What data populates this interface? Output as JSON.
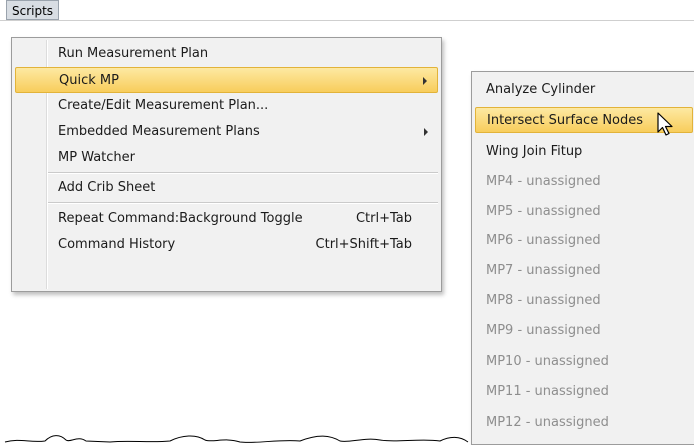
{
  "menubar": {
    "scripts_label": "Scripts"
  },
  "main_menu": {
    "items": [
      {
        "label": "Run Measurement Plan"
      },
      {
        "label": "Quick MP"
      },
      {
        "label": "Create/Edit Measurement Plan..."
      },
      {
        "label": "Embedded Measurement Plans"
      },
      {
        "label": "MP Watcher"
      },
      {
        "label": "Add Crib Sheet"
      },
      {
        "label": "Repeat Command:Background Toggle",
        "shortcut": "Ctrl+Tab"
      },
      {
        "label": "Command History",
        "shortcut": "Ctrl+Shift+Tab"
      }
    ]
  },
  "quick_mp_submenu": {
    "items": [
      {
        "label": "Analyze Cylinder"
      },
      {
        "label": "Intersect Surface Nodes"
      },
      {
        "label": "Wing Join Fitup"
      },
      {
        "label": "MP4 - unassigned"
      },
      {
        "label": "MP5 - unassigned"
      },
      {
        "label": "MP6 - unassigned"
      },
      {
        "label": "MP7 - unassigned"
      },
      {
        "label": "MP8 - unassigned"
      },
      {
        "label": "MP9 - unassigned"
      },
      {
        "label": "MP10 - unassigned"
      },
      {
        "label": "MP11 - unassigned"
      },
      {
        "label": "MP12 - unassigned"
      }
    ]
  },
  "colors": {
    "highlight": "#f8cd5c",
    "menu_background": "#f1f1f1",
    "disabled_text": "#8e8e8e"
  },
  "icons": {
    "submenu_arrow": "chevron-right-icon",
    "cursor": "mouse-pointer-icon"
  }
}
